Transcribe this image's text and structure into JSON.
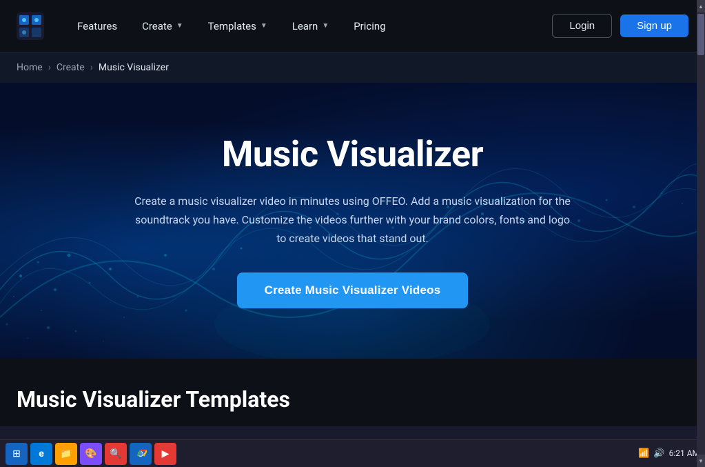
{
  "navbar": {
    "logo_alt": "OFFEO",
    "links": [
      {
        "label": "Features",
        "has_dropdown": false
      },
      {
        "label": "Create",
        "has_dropdown": true
      },
      {
        "label": "Templates",
        "has_dropdown": true
      },
      {
        "label": "Learn",
        "has_dropdown": true
      },
      {
        "label": "Pricing",
        "has_dropdown": false
      }
    ],
    "login_label": "Login",
    "signup_label": "Sign up"
  },
  "breadcrumb": {
    "home": "Home",
    "create": "Create",
    "current": "Music Visualizer"
  },
  "hero": {
    "title": "Music Visualizer",
    "description": "Create a music visualizer video in minutes using OFFEO. Add a music visualization for the soundtrack you have. Customize the videos further with your brand colors, fonts and logo to create videos that stand out.",
    "cta_label": "Create Music Visualizer Videos"
  },
  "below_hero": {
    "section_title": "Music Visualizer Templates"
  },
  "taskbar": {
    "time": "6:21 AM",
    "apps": [
      {
        "name": "start",
        "label": "⊞"
      },
      {
        "name": "ie",
        "label": "e"
      },
      {
        "name": "folder",
        "label": "📁"
      },
      {
        "name": "paint",
        "label": "🎨"
      },
      {
        "name": "search",
        "label": "🔍"
      },
      {
        "name": "chrome",
        "label": "●"
      },
      {
        "name": "offeo",
        "label": "🎬"
      }
    ]
  },
  "colors": {
    "navbar_bg": "#0d1117",
    "hero_bg": "#040d2a",
    "cta_bg": "#2196f3",
    "accent": "#1a73e8"
  }
}
